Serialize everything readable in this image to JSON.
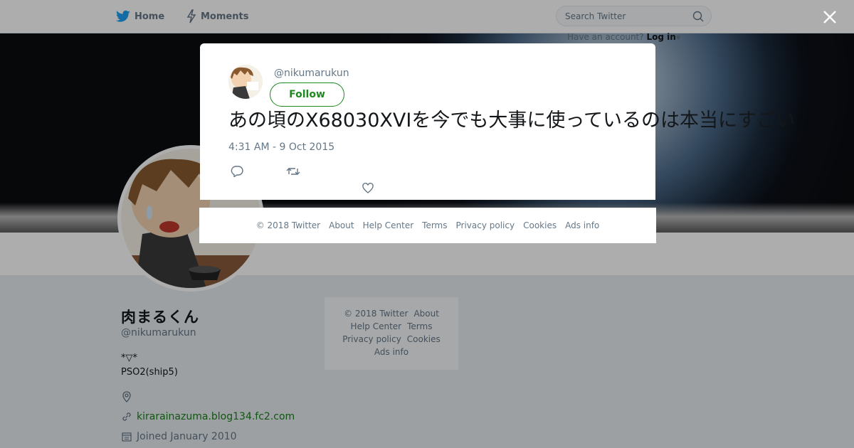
{
  "nav": {
    "home_label": "Home",
    "moments_label": "Moments",
    "search_placeholder": "Search Twitter",
    "account_prompt": "Have an account?",
    "login_label": "Log in"
  },
  "profile": {
    "display_name": "肉まるくん",
    "handle": "@nikumarukun",
    "bio_line1": "*▽*",
    "bio_line2": "PSO2(ship5)",
    "location": "",
    "website": "kirarainazuma.blog134.fc2.com",
    "joined": "Joined January 2010"
  },
  "sidebar_footer": {
    "copyright": "© 2018 Twitter",
    "about": "About",
    "help": "Help Center",
    "terms": "Terms",
    "privacy": "Privacy policy",
    "cookies": "Cookies",
    "ads": "Ads info"
  },
  "tweet": {
    "handle": "@nikumarukun",
    "follow_label": "Follow",
    "text": "あの頃のX68030XVIを今でも大事に使っているのは本当にすごい",
    "timestamp": "4:31 AM - 9 Oct 2015"
  },
  "modal_footer": {
    "copyright": "© 2018 Twitter",
    "about": "About",
    "help": "Help Center",
    "terms": "Terms",
    "privacy": "Privacy policy",
    "cookies": "Cookies",
    "ads": "Ads info"
  },
  "colors": {
    "brand": "#1da1f2",
    "link": "#1a7f1a",
    "follow": "#1d8a1d",
    "muted": "#657786"
  },
  "icons": [
    "twitter-bird-icon",
    "lightning-icon",
    "search-icon",
    "close-icon",
    "reply-icon",
    "retweet-icon",
    "heart-icon",
    "location-icon",
    "link-icon",
    "calendar-icon",
    "caret-down-icon"
  ]
}
